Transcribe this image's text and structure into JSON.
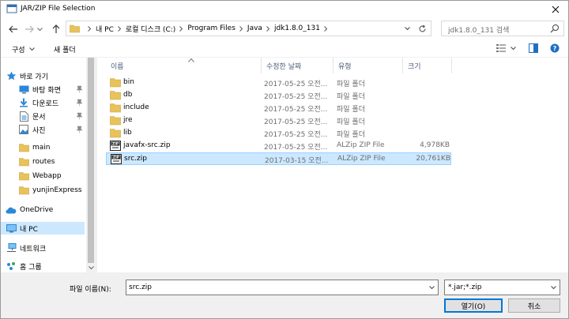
{
  "window": {
    "title": "JAR/ZIP File Selection"
  },
  "address": {
    "crumbs": [
      "내 PC",
      "로컬 디스크 (C:)",
      "Program Files",
      "Java",
      "jdk1.8.0_131"
    ]
  },
  "search": {
    "placeholder": "jdk1.8.0_131 검색"
  },
  "toolbar": {
    "organize_label": "구성",
    "new_folder_label": "새 폴더"
  },
  "nav": {
    "quick_access": "바로 가기",
    "items": [
      {
        "label": "바탕 화면",
        "icon": "desktop-icon",
        "pinned": true
      },
      {
        "label": "다운로드",
        "icon": "download-icon",
        "pinned": true
      },
      {
        "label": "문서",
        "icon": "documents-icon",
        "pinned": true
      },
      {
        "label": "사진",
        "icon": "pictures-icon",
        "pinned": true
      },
      {
        "label": "main",
        "icon": "folder-icon",
        "pinned": false
      },
      {
        "label": "routes",
        "icon": "folder-icon",
        "pinned": false
      },
      {
        "label": "Webapp",
        "icon": "folder-icon",
        "pinned": false
      },
      {
        "label": "yunjinExpress",
        "icon": "folder-icon",
        "pinned": false
      }
    ],
    "onedrive": "OneDrive",
    "this_pc": "내 PC",
    "network": "네트워크",
    "homegroup": "홈 그룹"
  },
  "columns": {
    "name": "이름",
    "date": "수정한 날짜",
    "type": "유형",
    "size": "크기"
  },
  "files": [
    {
      "name": "bin",
      "date": "2017-05-25 오전...",
      "type": "파일 폴더",
      "size": "",
      "icon": "folder-icon"
    },
    {
      "name": "db",
      "date": "2017-05-25 오전...",
      "type": "파일 폴더",
      "size": "",
      "icon": "folder-icon"
    },
    {
      "name": "include",
      "date": "2017-05-25 오전...",
      "type": "파일 폴더",
      "size": "",
      "icon": "folder-icon"
    },
    {
      "name": "jre",
      "date": "2017-05-25 오전...",
      "type": "파일 폴더",
      "size": "",
      "icon": "folder-icon"
    },
    {
      "name": "lib",
      "date": "2017-05-25 오전...",
      "type": "파일 폴더",
      "size": "",
      "icon": "folder-icon"
    },
    {
      "name": "javafx-src.zip",
      "date": "2017-05-25 오전...",
      "type": "ALZip ZIP File",
      "size": "4,978KB",
      "icon": "zip-file-icon"
    },
    {
      "name": "src.zip",
      "date": "2017-03-15 오전...",
      "type": "ALZip ZIP File",
      "size": "20,761KB",
      "icon": "zip-file-icon"
    }
  ],
  "filename": {
    "label": "파일 이름(N):",
    "value": "src.zip"
  },
  "filetype": {
    "value": "*.jar;*.zip"
  },
  "buttons": {
    "open": "열기(O)",
    "cancel": "취소"
  },
  "colors": {
    "selection": "#cce8ff",
    "selection_border": "#99d1ff",
    "folder": "#e8c25a",
    "accent": "#0078d7"
  }
}
